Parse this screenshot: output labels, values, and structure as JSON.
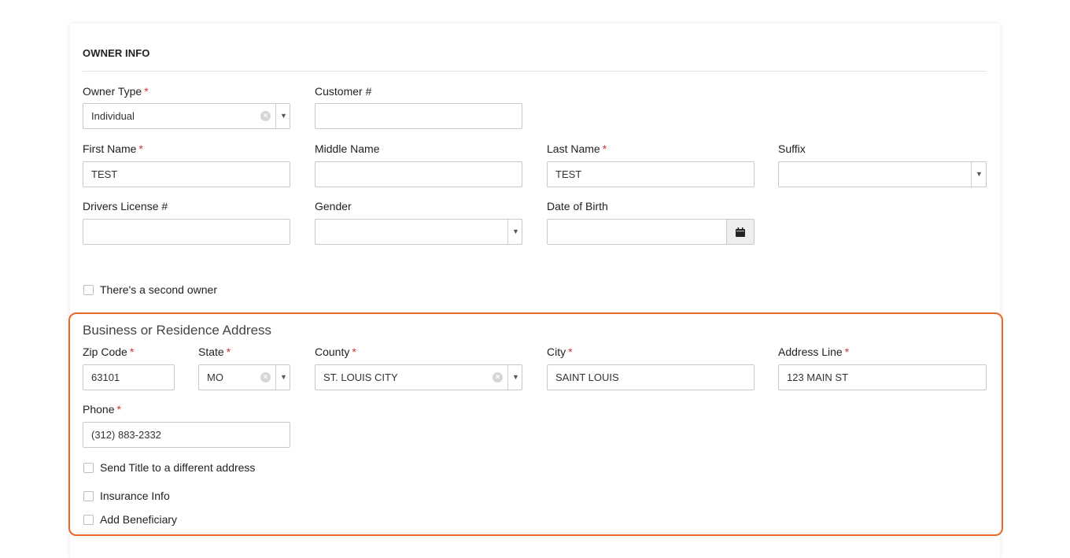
{
  "section": {
    "title": "OWNER INFO"
  },
  "owner_type": {
    "label": "Owner Type",
    "required": "*",
    "value": "Individual"
  },
  "customer_no": {
    "label": "Customer #",
    "value": ""
  },
  "first_name": {
    "label": "First Name",
    "required": "*",
    "value": "TEST"
  },
  "middle_name": {
    "label": "Middle Name",
    "value": ""
  },
  "last_name": {
    "label": "Last Name",
    "required": "*",
    "value": "TEST"
  },
  "suffix": {
    "label": "Suffix",
    "value": ""
  },
  "drivers_license": {
    "label": "Drivers License #",
    "value": ""
  },
  "gender": {
    "label": "Gender",
    "value": ""
  },
  "dob": {
    "label": "Date of Birth",
    "value": ""
  },
  "second_owner": {
    "label": "There's a second owner",
    "checked": false
  },
  "address": {
    "title": "Business or Residence Address",
    "zip": {
      "label": "Zip Code",
      "required": "*",
      "value": "63101"
    },
    "state": {
      "label": "State",
      "required": "*",
      "value": "MO"
    },
    "county": {
      "label": "County",
      "required": "*",
      "value": "ST. LOUIS CITY"
    },
    "city": {
      "label": "City",
      "required": "*",
      "value": "SAINT LOUIS"
    },
    "address_line": {
      "label": "Address Line",
      "required": "*",
      "value": "123 MAIN ST"
    },
    "phone": {
      "label": "Phone",
      "required": "*",
      "value": "(312) 883-2332"
    }
  },
  "checkboxes": {
    "send_title": {
      "label": "Send Title to a different address",
      "checked": false
    },
    "insurance": {
      "label": "Insurance Info",
      "checked": false
    },
    "beneficiary": {
      "label": "Add Beneficiary",
      "checked": false
    }
  },
  "colors": {
    "highlight": "#e8682a",
    "required": "#d32f2f"
  },
  "icons": {
    "clear": "clear-icon",
    "dropdown": "dropdown-arrow-icon",
    "calendar": "calendar-icon"
  }
}
